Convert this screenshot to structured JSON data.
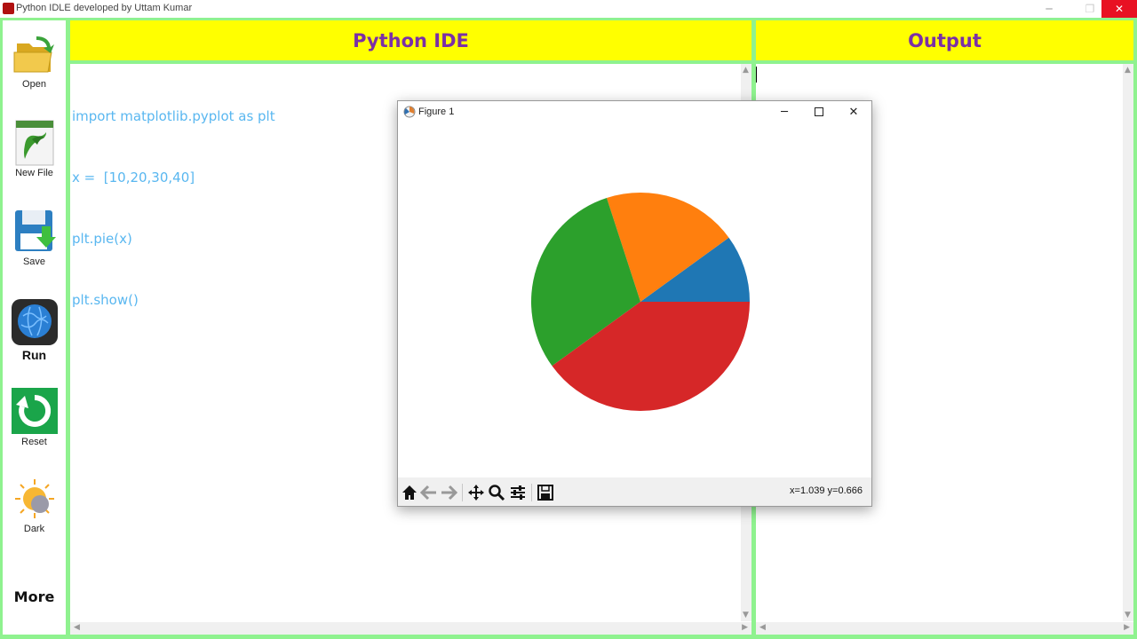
{
  "window": {
    "title": "Python IDLE developed by Uttam Kumar",
    "minimize_label": "─",
    "maximize_label": "❐",
    "close_label": "✕"
  },
  "sidebar": {
    "items": [
      {
        "label": "Open",
        "icon": "folder-open-icon"
      },
      {
        "label": "New File",
        "icon": "python-file-icon"
      },
      {
        "label": "Save",
        "icon": "save-disk-icon"
      },
      {
        "label": "Run",
        "icon": "run-globe-icon"
      },
      {
        "label": "Reset",
        "icon": "reset-arrow-icon"
      },
      {
        "label": "Dark",
        "icon": "sun-moon-icon"
      }
    ],
    "more_label": "More"
  },
  "headers": {
    "ide": "Python IDE",
    "output": "Output"
  },
  "editor": {
    "code_lines": [
      "import matplotlib.pyplot as plt",
      "x =  [10,20,30,40]",
      "plt.pie(x)",
      "plt.show()"
    ]
  },
  "output": {
    "text": ""
  },
  "figure": {
    "title": "Figure 1",
    "coords": "x=1.039 y=0.666",
    "toolbar": [
      "home-icon",
      "back-arrow-icon",
      "forward-arrow-icon",
      "pan-move-icon",
      "zoom-magnifier-icon",
      "configure-sliders-icon",
      "save-figure-icon"
    ]
  },
  "chart_data": {
    "type": "pie",
    "values": [
      10,
      20,
      30,
      40
    ],
    "colors": [
      "#1f77b4",
      "#ff7f0e",
      "#2ca02c",
      "#d62728"
    ],
    "start_angle_deg": 0,
    "direction": "counterclockwise",
    "title": "",
    "legend": "none"
  },
  "colors": {
    "frame": "#8ff28f",
    "header_bg": "#ffff00",
    "header_text": "#7b2fa6",
    "code_text": "#59b7f0"
  }
}
